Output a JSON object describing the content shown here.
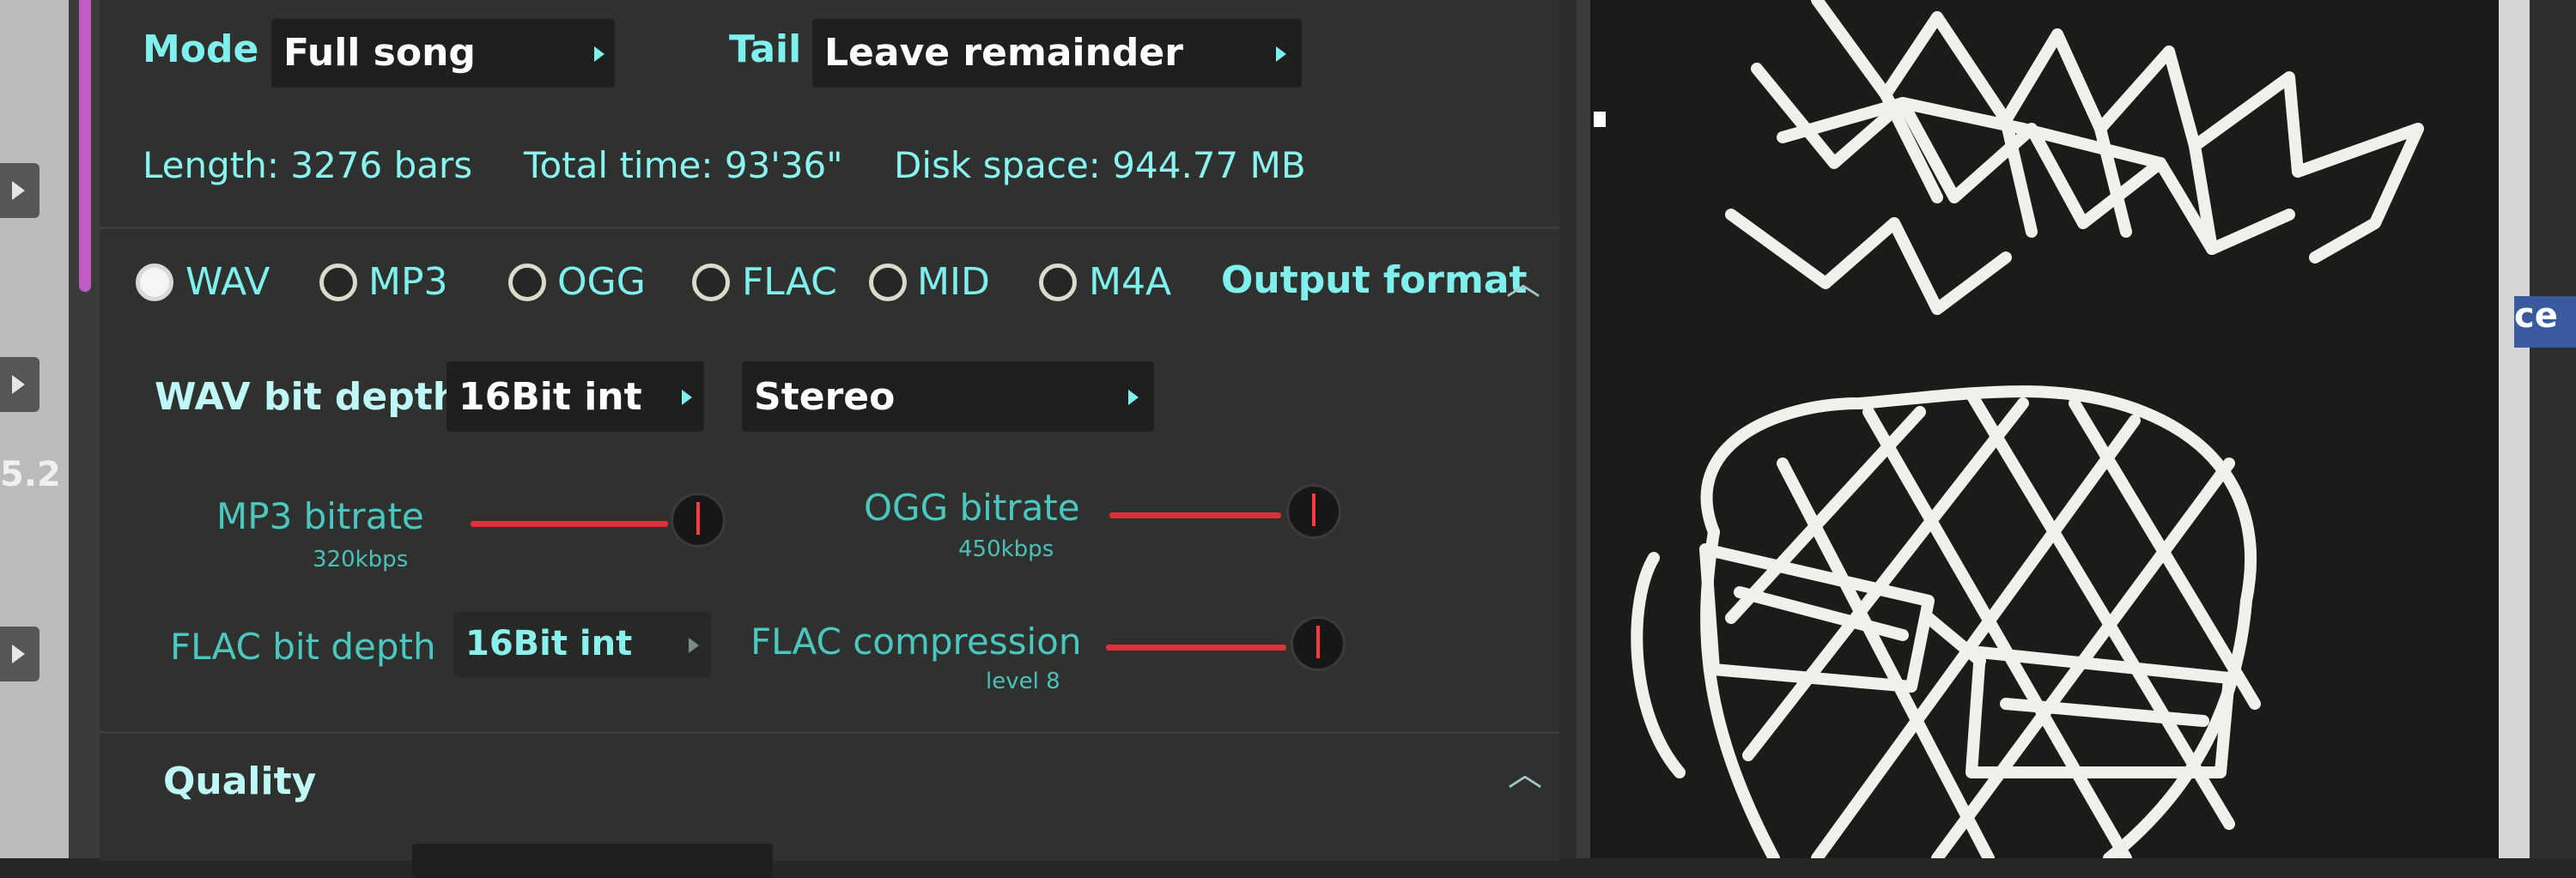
{
  "side": {
    "number": "5.2"
  },
  "render": {
    "mode_label": "Mode",
    "mode_value": "Full song",
    "tail_label": "Tail",
    "tail_value": "Leave remainder",
    "length_text": "Length: 3276 bars",
    "total_time_text": "Total time: 93'36\"",
    "disk_space_text": "Disk space: 944.77 MB"
  },
  "output_format": {
    "title": "Output format",
    "selected": "WAV",
    "options": [
      "WAV",
      "MP3",
      "OGG",
      "FLAC",
      "MID",
      "M4A"
    ],
    "wav_bit_depth_label": "WAV bit depth",
    "wav_bit_depth_value": "16Bit int",
    "channels_value": "Stereo",
    "mp3_bitrate_label": "MP3 bitrate",
    "mp3_bitrate_value": "320kbps",
    "ogg_bitrate_label": "OGG bitrate",
    "ogg_bitrate_value": "450kbps",
    "flac_bit_depth_label": "FLAC bit depth",
    "flac_bit_depth_value": "16Bit int",
    "flac_compression_label": "FLAC compression",
    "flac_compression_value": "level 8"
  },
  "quality": {
    "title": "Quality"
  },
  "right": {
    "tag_text": "ce"
  },
  "colors": {
    "accent": "#c05ac5",
    "label": "#7ff0ee",
    "slider": "#e0303a",
    "panel": "#2c2e2c"
  },
  "icons": [
    "chevron-up-icon",
    "dropdown-arrow-icon",
    "radio-icon",
    "knob-icon"
  ]
}
